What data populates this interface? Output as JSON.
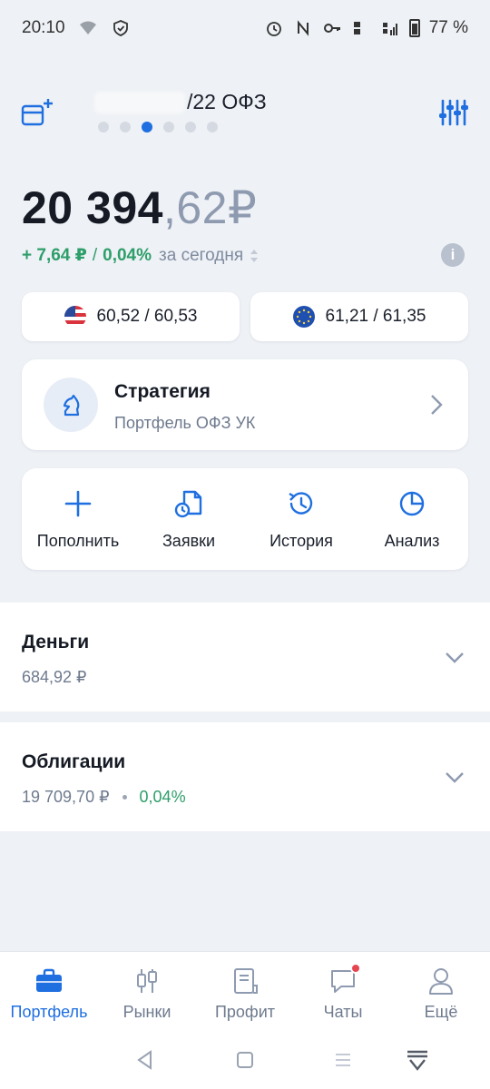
{
  "status_bar": {
    "time": "20:10",
    "battery": "77 %"
  },
  "header": {
    "title": "/22 ОФЗ",
    "page_dots": 6,
    "active_dot": 2
  },
  "balance": {
    "whole": "20 394",
    "fraction": ",62",
    "currency": "₽"
  },
  "change": {
    "amount": "+ 7,64 ₽",
    "separator": "/",
    "percent": "0,04%",
    "period": "за сегодня"
  },
  "rates": {
    "usd": {
      "value": "60,52 / 60,53"
    },
    "eur": {
      "value": "61,21 / 61,35"
    }
  },
  "strategy": {
    "title": "Стратегия",
    "subtitle": "Портфель ОФЗ УК"
  },
  "actions": [
    {
      "label": "Пополнить",
      "icon": "plus-icon"
    },
    {
      "label": "Заявки",
      "icon": "orders-icon"
    },
    {
      "label": "История",
      "icon": "history-icon"
    },
    {
      "label": "Анализ",
      "icon": "pie-chart-icon"
    }
  ],
  "sections": {
    "money": {
      "title": "Деньги",
      "amount": "684,92 ₽"
    },
    "bonds": {
      "title": "Облигации",
      "amount": "19 709,70 ₽",
      "percent": "0,04%"
    }
  },
  "tabs": [
    {
      "label": "Портфель",
      "icon": "briefcase-icon",
      "active": true
    },
    {
      "label": "Рынки",
      "icon": "candles-icon",
      "active": false
    },
    {
      "label": "Профит",
      "icon": "document-icon",
      "active": false
    },
    {
      "label": "Чаты",
      "icon": "chat-icon",
      "active": false,
      "badge": true
    },
    {
      "label": "Ещё",
      "icon": "profile-icon",
      "active": false
    }
  ],
  "colors": {
    "accent": "#1f6fe0",
    "positive": "#2e9e6a",
    "badge": "#e64650"
  }
}
